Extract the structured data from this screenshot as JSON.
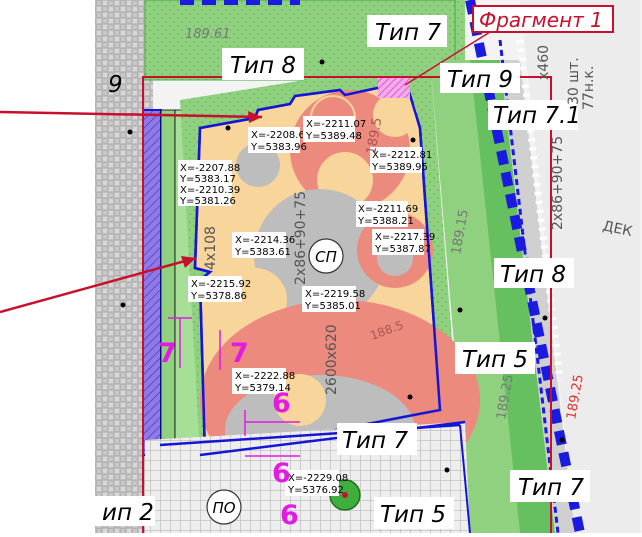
{
  "fragment": {
    "label": "Фрагмент 1",
    "color": "#c8102e"
  },
  "types": {
    "t7_top": "Тип 7",
    "t8_top": "Тип 8",
    "t9": "Тип 9",
    "t71": "Тип 7.1",
    "t8_right": "Тип 8",
    "t5_right": "Тип 5",
    "t7_mid": "Тип 7",
    "t7_bottom_right": "Тип 7",
    "t5_bottom": "Тип 5",
    "t2_left": "ип 2",
    "t9_left": "9"
  },
  "circles": {
    "sp": "СП",
    "po": "ПО"
  },
  "coords": [
    {
      "x": "X=-2208.67",
      "y": "Y=5383.96"
    },
    {
      "x": "X=-2211.07",
      "y": "Y=5389.48"
    },
    {
      "x": "X=-2207.88",
      "y": "Y=5383.17"
    },
    {
      "x": "X=-2210.39",
      "y": "Y=5381.26"
    },
    {
      "x": "X=-2212.81",
      "y": "Y=5389.95"
    },
    {
      "x": "X=-2211.69",
      "y": "Y=5388.21"
    },
    {
      "x": "X=-2214.36",
      "y": "Y=5383.61"
    },
    {
      "x": "X=-2217.39",
      "y": "Y=5387.87"
    },
    {
      "x": "X=-2215.92",
      "y": "Y=5378.86"
    },
    {
      "x": "X=-2219.58",
      "y": "Y=5385.01"
    },
    {
      "x": "X=-2222.88",
      "y": "Y=5379.14"
    },
    {
      "x": "X=-2229.08",
      "y": "Y=5376.92"
    }
  ],
  "marks": {
    "m7a": "7",
    "m7b": "7",
    "m6a": "6",
    "m6b": "6",
    "m6c": "6"
  },
  "dims": {
    "d1": "2x86+90+75",
    "d2": "2600x620",
    "d3": "4x108",
    "d4": "2x86+90+75",
    "d5": "x460",
    "d6": "30 шт.",
    "d7": "77н.к.",
    "d8": "ДЕК"
  },
  "elevations": [
    "189.61",
    "189.25",
    "189.5",
    "188.5",
    "189.15",
    "189.25"
  ],
  "colors": {
    "green": "#9fd98f",
    "dark_green": "#3fae3f",
    "sand": "#f7d59b",
    "salmon": "#ec8a7d",
    "gray": "#bdbdbd",
    "blue": "#1515d6",
    "purple": "#8f7be8"
  }
}
